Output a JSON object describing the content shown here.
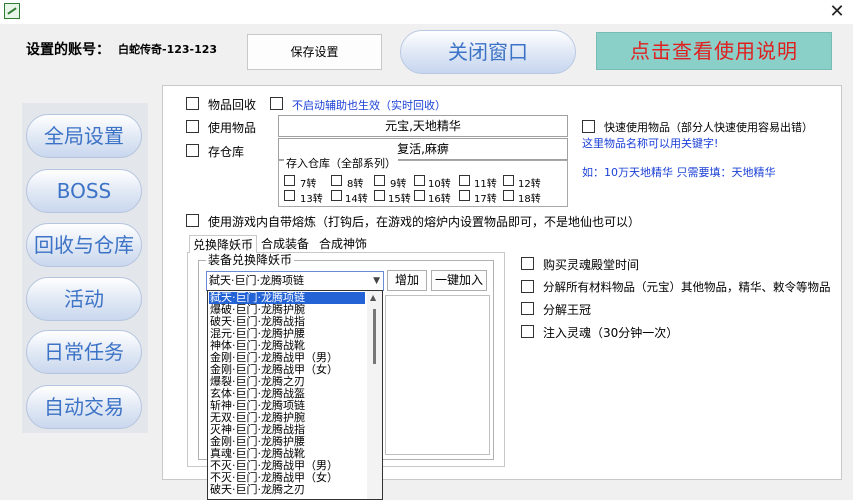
{
  "window": {
    "close_glyph": "✕"
  },
  "account": {
    "label": "设置的账号：",
    "value": "白蛇传奇-123-123"
  },
  "top_buttons": {
    "save": "保存设置",
    "close_window": "关闭窗口",
    "help": "点击查看使用说明"
  },
  "nav": [
    "全局设置",
    "BOSS",
    "回收与仓库",
    "活动",
    "日常任务",
    "自动交易"
  ],
  "options": {
    "item_recycle": "物品回收",
    "no_assist_note": "不启动辅助也生效（实时回收）",
    "use_items": "使用物品",
    "use_items_value": "元宝,天地精华",
    "storage": "存仓库",
    "storage_value": "复活,麻痹",
    "store_group_title": "存入仓库（全部系列）",
    "turns_row1": [
      "7转",
      "8转",
      "9转",
      "10转",
      "11转",
      "12转"
    ],
    "turns_row2": [
      "13转",
      "14转",
      "15转",
      "16转",
      "17转",
      "18转"
    ],
    "fast_use": "快速使用物品（部分人快速使用容易出错）",
    "keyword_note": "这里物品名称可以用关键字!",
    "example_note": "如：10万天地精华   只需要填：天地精华",
    "furnace": "使用游戏内自带熔炼（打钩后，在游戏的熔炉内设置物品即可，不是地仙也可以）"
  },
  "tabs": [
    "兑换降妖币",
    "合成装备",
    "合成神饰"
  ],
  "exchange": {
    "group_title": "装备兑换降妖币",
    "selected": "弑天·巨门·龙腾项链",
    "add_button": "增加",
    "add_all_button": "一键加入",
    "dropdown_items": [
      "弑天·巨门·龙腾项链",
      "爆破·巨门·龙腾护腕",
      "破天·巨门·龙腾战指",
      "混元·巨门·龙腾护腰",
      "神体·巨门·龙腾战靴",
      "金刚·巨门·龙腾战甲（男）",
      "金刚·巨门·龙腾战甲（女）",
      "爆裂·巨门·龙腾之刃",
      "玄体·巨门·龙腾战盔",
      "斩神·巨门·龙腾项链",
      "无双·巨门·龙腾护腕",
      "灭神·巨门·龙腾战指",
      "金刚·巨门·龙腾护腰",
      "真魂·巨门·龙腾战靴",
      "不灭·巨门·龙腾战甲（男）",
      "不灭·巨门·龙腾战甲（女）",
      "破天·巨门·龙腾之刃"
    ]
  },
  "right_options": {
    "buy_soul": "购买灵魂殿堂时间",
    "decompose_all": "分解所有材料物品（元宝）其他物品，精华、敕令等物品",
    "decompose_crown": "分解王冠",
    "inject_soul": "注入灵魂（30分钟一次）"
  },
  "colors": {
    "accent_blue": "#3d73c6",
    "help_bg": "#8ad0c8",
    "help_text": "#e02020",
    "note_blue": "#1a3fd6",
    "selection": "#2463d6"
  }
}
